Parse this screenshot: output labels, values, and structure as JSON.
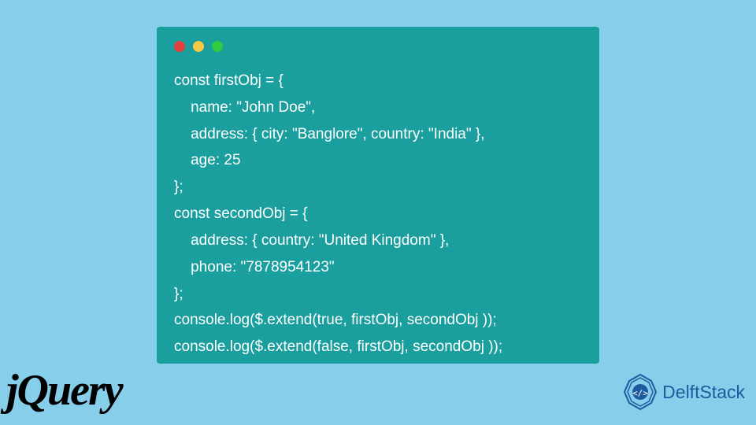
{
  "code": {
    "lines": [
      "const firstObj = {",
      "    name: \"John Doe\",",
      "    address: { city: \"Banglore\", country: \"India\" },",
      "    age: 25",
      "};",
      "const secondObj = {",
      "    address: { country: \"United Kingdom\" },",
      "    phone: \"7878954123\"",
      "};",
      "console.log($.extend(true, firstObj, secondObj ));",
      "console.log($.extend(false, firstObj, secondObj ));"
    ]
  },
  "logos": {
    "jquery": "jQuery",
    "delftstack": "DelftStack"
  }
}
